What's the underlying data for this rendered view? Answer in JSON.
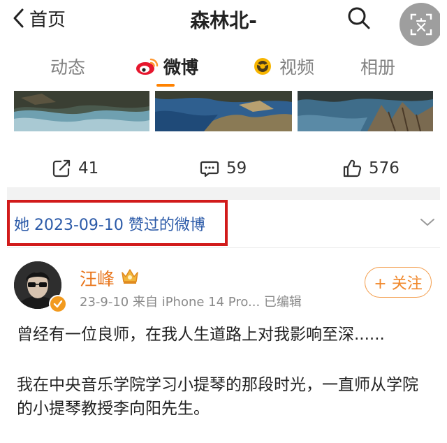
{
  "nav": {
    "back_label": "首页",
    "title": "森林北-"
  },
  "tabs": [
    {
      "label": "动态",
      "active": false
    },
    {
      "label": "微博",
      "active": true
    },
    {
      "label": "视频",
      "active": false
    },
    {
      "label": "相册",
      "active": false
    }
  ],
  "actions": {
    "repost": "41",
    "comment": "59",
    "like": "576"
  },
  "liked_notice": "她 2023-09-10 赞过的微博",
  "post": {
    "author": "汪峰",
    "meta": "23-9-10  来自 iPhone 14 Pro...  已编辑",
    "follow_label": "+ 关注",
    "paragraphs": [
      "曾经有一位良师，在我人生道路上对我影响至深......",
      "我在中央音乐学院学习小提琴的那段时光，一直师从学院",
      "的小提琴教授李向阳先生。"
    ]
  },
  "colors": {
    "accent": "#ff8200",
    "link": "#2b5aa8",
    "author": "#e8741a",
    "highlight_box": "#d11b1b"
  }
}
